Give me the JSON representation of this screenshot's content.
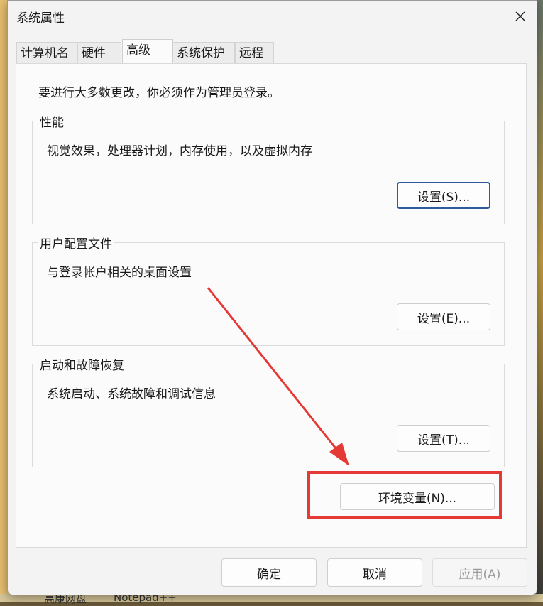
{
  "window": {
    "title": "系统属性"
  },
  "tabs": [
    {
      "label": "计算机名"
    },
    {
      "label": "硬件"
    },
    {
      "label": "高级",
      "active": true
    },
    {
      "label": "系统保护"
    },
    {
      "label": "远程"
    }
  ],
  "advanced": {
    "admin_note": "要进行大多数更改，你必须作为管理员登录。",
    "performance": {
      "label": "性能",
      "desc": "视觉效果，处理器计划，内存使用，以及虚拟内存",
      "button": "设置(S)..."
    },
    "user_profiles": {
      "label": "用户配置文件",
      "desc": "与登录帐户相关的桌面设置",
      "button": "设置(E)..."
    },
    "startup": {
      "label": "启动和故障恢复",
      "desc": "系统启动、系统故障和调试信息",
      "button": "设置(T)..."
    },
    "env_button": "环境变量(N)..."
  },
  "footer": {
    "ok": "确定",
    "cancel": "取消",
    "apply": "应用(A)"
  },
  "taskbar": {
    "items": [
      "高康网盘",
      "Notepad++"
    ]
  },
  "colors": {
    "annotation": "#e53935",
    "focus": "#2f5a9a"
  }
}
